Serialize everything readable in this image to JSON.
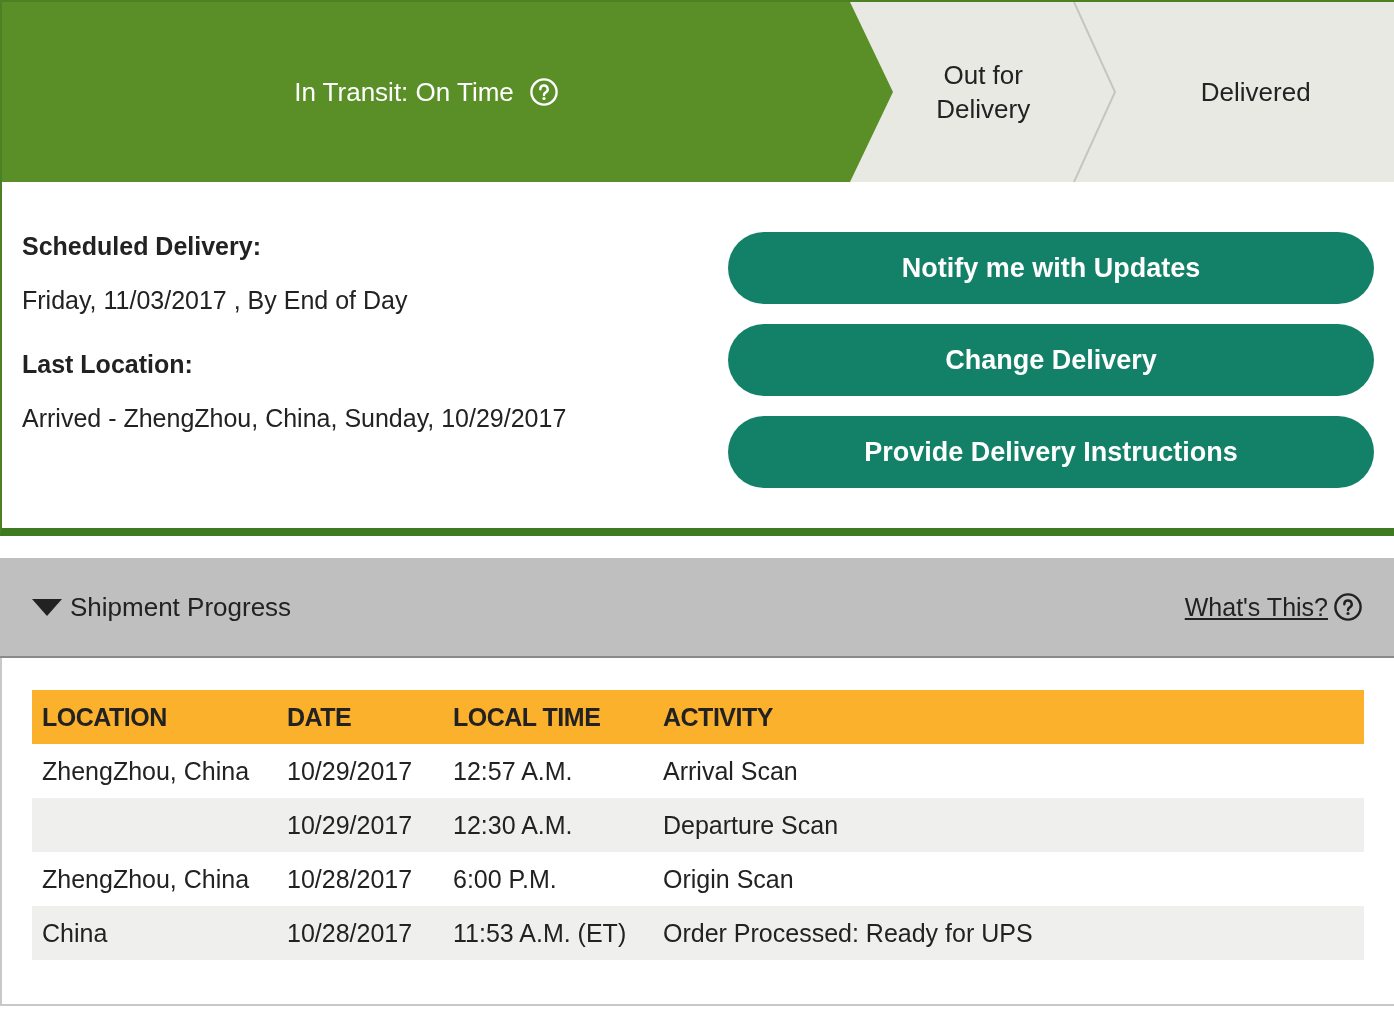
{
  "steps": [
    {
      "label": "In Transit: On Time",
      "current": true,
      "help_icon": true
    },
    {
      "label": "Out for Delivery",
      "current": false,
      "help_icon": false
    },
    {
      "label": "Delivered",
      "current": false,
      "help_icon": false
    }
  ],
  "details": [
    {
      "label": "Scheduled Delivery:",
      "value": "Friday, 11/03/2017 , By End of Day"
    },
    {
      "label": "Last Location:",
      "value": "Arrived - ZhengZhou, China, Sunday, 10/29/2017"
    }
  ],
  "buttons": [
    "Notify me with Updates",
    "Change Delivery",
    "Provide Delivery Instructions"
  ],
  "shipment_progress": {
    "title": "Shipment Progress",
    "expanded": true,
    "help_link": "What's This?",
    "table": {
      "columns": [
        "LOCATION",
        "DATE",
        "LOCAL TIME",
        "ACTIVITY"
      ],
      "rows": [
        {
          "location": "ZhengZhou, China",
          "date": "10/29/2017",
          "local_time": "12:57 A.M.",
          "activity": "Arrival Scan"
        },
        {
          "date": "10/29/2017",
          "local_time": "12:30 A.M.",
          "activity": "Departure Scan"
        },
        {
          "location": "ZhengZhou, China",
          "date": "10/28/2017",
          "local_time": "6:00 P.M.",
          "activity": "Origin Scan"
        },
        {
          "location": "China",
          "date": "10/28/2017",
          "local_time": "11:53 A.M. (ET)",
          "activity": "Order Processed: Ready for UPS"
        }
      ]
    }
  }
}
